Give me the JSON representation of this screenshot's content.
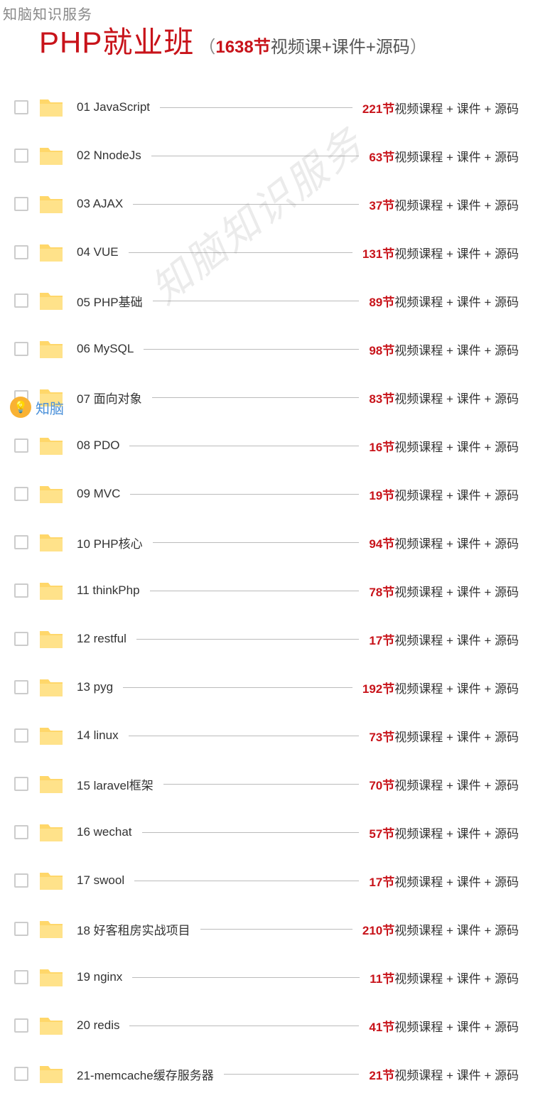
{
  "watermarks": {
    "top_left": "知脑知识服务",
    "diagonal": "知脑知识服务",
    "logo_text": "知脑"
  },
  "header": {
    "title": "PHP就业班",
    "paren_open": "（",
    "count": "1638节",
    "suffix": "视频课+课件+源码",
    "paren_close": "）"
  },
  "row_suffix": "视频课程 + 课件 + 源码",
  "folders": [
    {
      "name": "01 JavaScript",
      "count": "221节"
    },
    {
      "name": "02 NnodeJs",
      "count": "63节"
    },
    {
      "name": "03 AJAX",
      "count": "37节"
    },
    {
      "name": "04 VUE",
      "count": "131节"
    },
    {
      "name": "05 PHP基础",
      "count": "89节"
    },
    {
      "name": "06 MySQL",
      "count": "98节"
    },
    {
      "name": "07 面向对象",
      "count": "83节"
    },
    {
      "name": "08 PDO",
      "count": "16节"
    },
    {
      "name": "09 MVC",
      "count": "19节"
    },
    {
      "name": "10 PHP核心",
      "count": "94节"
    },
    {
      "name": "11 thinkPhp",
      "count": "78节"
    },
    {
      "name": "12 restful",
      "count": "17节"
    },
    {
      "name": "13 pyg",
      "count": "192节"
    },
    {
      "name": "14 linux",
      "count": "73节"
    },
    {
      "name": "15 laravel框架",
      "count": "70节"
    },
    {
      "name": "16 wechat",
      "count": "57节"
    },
    {
      "name": "17 swool",
      "count": "17节"
    },
    {
      "name": "18 好客租房实战项目",
      "count": "210节"
    },
    {
      "name": "19 nginx",
      "count": "11节"
    },
    {
      "name": "20 redis",
      "count": "41节"
    },
    {
      "name": "21-memcache缓存服务器",
      "count": "21节"
    }
  ]
}
